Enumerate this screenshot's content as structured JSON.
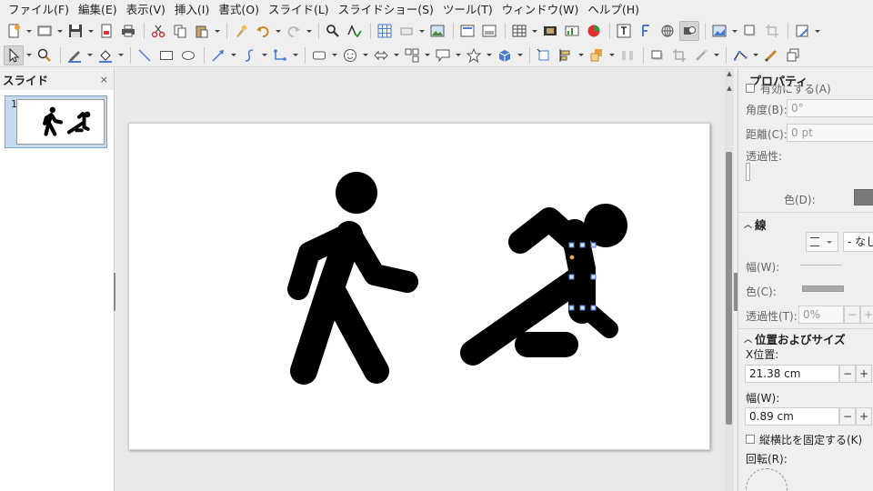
{
  "menu": [
    "ファイル(F)",
    "編集(E)",
    "表示(V)",
    "挿入(I)",
    "書式(O)",
    "スライド(L)",
    "スライドショー(S)",
    "ツール(T)",
    "ウィンドウ(W)",
    "ヘルプ(H)"
  ],
  "slide_pane": {
    "title": "スライド",
    "close": "×",
    "slide_number": "1"
  },
  "properties": {
    "title": "プロパティ",
    "enable_label": "有効にする(A)",
    "angle_label": "角度(B):",
    "angle_value": "0°",
    "distance_label": "距離(C):",
    "distance_value": "0 pt",
    "transparency_label": "透過性:",
    "color_label": "色(D):",
    "line_section": "線",
    "line_style_value": "- なし",
    "width_label": "幅(W):",
    "line_color_label": "色(C):",
    "line_transparency_label": "透過性(T):",
    "line_transparency_value": "0%",
    "minus": "−",
    "plus": "+",
    "position_section": "位置およびサイズ",
    "xpos_label": "X位置:",
    "xpos_value": "21.38 cm",
    "width2_label": "幅(W):",
    "width2_value": "0.89 cm",
    "keep_ratio_label": "縦横比を固定する(K)",
    "rotation_label": "回転(R):"
  },
  "colors": {
    "accent": "#4a7bd0",
    "shadow_swatch": "#7a7a7a"
  },
  "icons": {
    "toolbar1": [
      "new-icon",
      "template-icon",
      "save-icon",
      "export-pdf-icon",
      "print-icon",
      "cut-icon",
      "copy-icon",
      "paste-icon",
      "clone-format-icon",
      "undo-icon",
      "redo-icon",
      "find-replace-icon",
      "spelling-icon",
      "grid-icon",
      "display-views-icon",
      "image-icon",
      "master-slide-icon",
      "slide-layout-icon",
      "table-icon",
      "movie-icon",
      "chart-icon",
      "pie-icon",
      "textbox-icon",
      "fontwork-icon",
      "hyperlink-icon",
      "object-icon",
      "picture-icon",
      "shadow-icon",
      "crop-icon",
      "line-icon"
    ],
    "toolbar2": [
      "select-icon",
      "zoom-icon",
      "line-color-icon",
      "fill-color-icon",
      "line-tool-icon",
      "rectangle-icon",
      "ellipse-icon",
      "arrow-icon",
      "curve-icon",
      "connector-icon",
      "basic-shapes-icon",
      "symbol-shapes-icon",
      "block-arrows-icon",
      "flowchart-icon",
      "callouts-icon",
      "stars-icon",
      "3d-object-icon",
      "rotate-icon",
      "align-icon",
      "arrange-icon",
      "distribute-icon",
      "shadow-toggle-icon",
      "crop-image-icon",
      "filter-icon",
      "points-icon",
      "glue-icon",
      "toggle-extrusion-icon"
    ]
  }
}
